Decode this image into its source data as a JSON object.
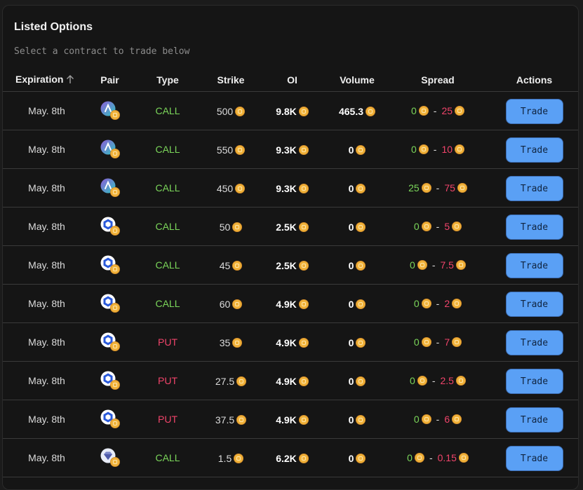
{
  "panel": {
    "title": "Listed Options",
    "subtitle": "Select a contract to trade below"
  },
  "columns": {
    "expiration": "Expiration",
    "pair": "Pair",
    "type": "Type",
    "strike": "Strike",
    "oi": "OI",
    "volume": "Volume",
    "spread": "Spread",
    "actions": "Actions"
  },
  "colors": {
    "call": "#7bd65a",
    "put": "#f0446a",
    "trade_button": "#5aa0f5",
    "coin": "#f0b23a"
  },
  "rows": [
    {
      "expiration": "May. 8th",
      "pair_icon": "arb-token-icon",
      "type": "CALL",
      "strike": "500",
      "oi": "9.8K",
      "volume": "465.3",
      "bid": "0",
      "ask": "25",
      "action": "Trade"
    },
    {
      "expiration": "May. 8th",
      "pair_icon": "arb-token-icon",
      "type": "CALL",
      "strike": "550",
      "oi": "9.3K",
      "volume": "0",
      "bid": "0",
      "ask": "10",
      "action": "Trade"
    },
    {
      "expiration": "May. 8th",
      "pair_icon": "arb-token-icon",
      "type": "CALL",
      "strike": "450",
      "oi": "9.3K",
      "volume": "0",
      "bid": "25",
      "ask": "75",
      "action": "Trade"
    },
    {
      "expiration": "May. 8th",
      "pair_icon": "link-token-icon",
      "type": "CALL",
      "strike": "50",
      "oi": "2.5K",
      "volume": "0",
      "bid": "0",
      "ask": "5",
      "action": "Trade"
    },
    {
      "expiration": "May. 8th",
      "pair_icon": "link-token-icon",
      "type": "CALL",
      "strike": "45",
      "oi": "2.5K",
      "volume": "0",
      "bid": "0",
      "ask": "7.5",
      "action": "Trade"
    },
    {
      "expiration": "May. 8th",
      "pair_icon": "link-token-icon",
      "type": "CALL",
      "strike": "60",
      "oi": "4.9K",
      "volume": "0",
      "bid": "0",
      "ask": "2",
      "action": "Trade"
    },
    {
      "expiration": "May. 8th",
      "pair_icon": "link-token-icon",
      "type": "PUT",
      "strike": "35",
      "oi": "4.9K",
      "volume": "0",
      "bid": "0",
      "ask": "7",
      "action": "Trade"
    },
    {
      "expiration": "May. 8th",
      "pair_icon": "link-token-icon",
      "type": "PUT",
      "strike": "27.5",
      "oi": "4.9K",
      "volume": "0",
      "bid": "0",
      "ask": "2.5",
      "action": "Trade"
    },
    {
      "expiration": "May. 8th",
      "pair_icon": "link-token-icon",
      "type": "PUT",
      "strike": "37.5",
      "oi": "4.9K",
      "volume": "0",
      "bid": "0",
      "ask": "6",
      "action": "Trade"
    },
    {
      "expiration": "May. 8th",
      "pair_icon": "diamond-token-icon",
      "type": "CALL",
      "strike": "1.5",
      "oi": "6.2K",
      "volume": "0",
      "bid": "0",
      "ask": "0.15",
      "action": "Trade"
    }
  ]
}
